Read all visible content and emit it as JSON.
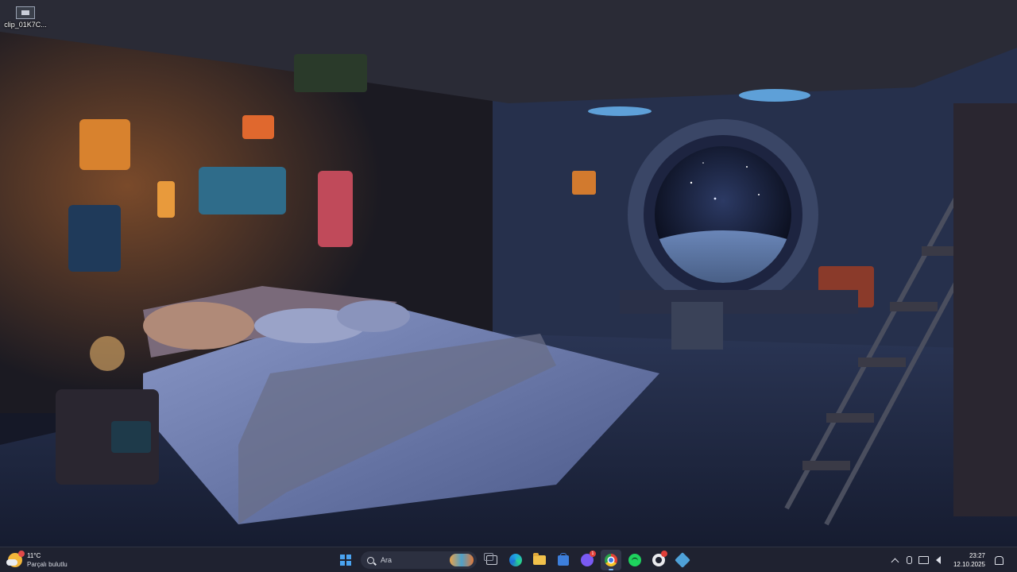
{
  "desktop": {
    "icons": [
      {
        "label": "clip_01K7C..."
      }
    ]
  },
  "taskbar": {
    "weather": {
      "temperature": "11°C",
      "condition": "Parçalı bulutlu"
    },
    "search": {
      "placeholder": "Ara"
    },
    "pinned_apps": [
      {
        "name": "start-icon"
      },
      {
        "name": "search"
      },
      {
        "name": "task-view-icon"
      },
      {
        "name": "edge-icon"
      },
      {
        "name": "file-explorer-icon"
      },
      {
        "name": "microsoft-store-icon"
      },
      {
        "name": "discord-icon",
        "badge": "1"
      },
      {
        "name": "chrome-icon",
        "active": true
      },
      {
        "name": "spotify-icon"
      },
      {
        "name": "github-desktop-icon",
        "badge": ""
      },
      {
        "name": "app-icon"
      }
    ],
    "clock": {
      "time": "23:27",
      "date": "12.10.2025"
    }
  },
  "colors": {
    "taskbar_bg": "#1f2230",
    "accent": "#4aa3f0",
    "wallpaper_warm": "#e08a3c",
    "wallpaper_cool": "#3d5fa8"
  }
}
